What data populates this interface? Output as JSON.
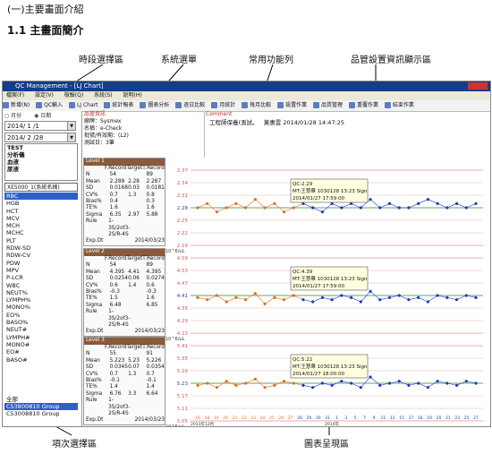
{
  "doc": {
    "section_title": "(一)主要畫面介紹",
    "subsection_title": "1.1 主畫面簡介"
  },
  "callouts": {
    "period": "時段選擇區",
    "system_menu": "系統選單",
    "functions": "常用功能列",
    "manager_info": "品管設置資訊顯示區",
    "items_area": "項次選擇區",
    "chart_area": "圖表呈現區"
  },
  "window": {
    "title": "QC Management - [LJ Chart]",
    "menu": [
      "檔案(F)",
      "設定(V)",
      "檢驗(Q)",
      "系統(S)",
      "說明(H)"
    ],
    "toolbar": [
      "新增(N)",
      "QC輸入",
      "LJ Chart",
      "統計報表",
      "圖表分析",
      "逐日比較",
      "月統計",
      "毎月比較",
      "設置作業",
      "品質管理",
      "重覆作業",
      "結束作業"
    ]
  },
  "left": {
    "radio": [
      "月份",
      "日期"
    ],
    "date_from": "2014/ 1 /1",
    "date_to": "2014/ 2 /28",
    "list1": [
      "TEST",
      "分析儀",
      "血液",
      "尿液"
    ],
    "instrument": "XE5000_1(系統名稱)",
    "items": [
      "RBC",
      "HGB",
      "HCT",
      "MCV",
      "MCH",
      "MCHC",
      "PLT",
      "RDW-SD",
      "RDW-CV",
      "PDW",
      "MPV",
      "P-LCR",
      "WBC",
      "NEUT%",
      "LYMPH%",
      "MONO%",
      "EO%",
      "BASO%",
      "NEUT#",
      "LYMPH#",
      "MONO#",
      "EO#",
      "BASO#"
    ],
    "selected_item": "RBC",
    "groups": [
      "全部",
      "C53800810 Group",
      "C53008810 Group"
    ],
    "selected_group": "C53800810 Group"
  },
  "info": {
    "header": "品管資訊",
    "lines": [
      "廠牌：Sysmex",
      "名稱：e-Check",
      "批號/有效期：(L2)",
      "測試日：3筆"
    ]
  },
  "comment": {
    "header": "Comment",
    "text": "工程師保養(測試。",
    "signed": "黃惠雲 2014/01/28 14:47:25"
  },
  "stats": [
    {
      "level": "Level 1",
      "cols": [
        "",
        "F.Record",
        "Target",
        "T.Record"
      ],
      "rows": [
        [
          "N",
          "54",
          "",
          "89"
        ],
        [
          "Mean",
          "2.289",
          "2.28",
          "2.287"
        ],
        [
          "SD",
          "0.0168",
          "0.03",
          "0.0181"
        ],
        [
          "CV%",
          "0.7",
          "1.3",
          "0.8"
        ],
        [
          "Bias%",
          "0.4",
          "",
          "0.3"
        ],
        [
          "TE%",
          "1.6",
          "",
          "1.6"
        ],
        [
          "Sigma",
          "6.35",
          "2.97",
          "5.88"
        ],
        [
          "Rule",
          "1-3S/2of3-2S/R-4S",
          "",
          ""
        ],
        [
          "Exp.Dt",
          "",
          "",
          "2014/03/23"
        ]
      ]
    },
    {
      "level": "Level 2",
      "cols": [
        "",
        "F.Record",
        "Target",
        "T.Record"
      ],
      "rows": [
        [
          "N",
          "54",
          "",
          "89"
        ],
        [
          "Mean",
          "4.395",
          "4.41",
          "4.395"
        ],
        [
          "SD",
          "0.0254",
          "0.06",
          "0.0274"
        ],
        [
          "CV%",
          "0.6",
          "1.4",
          "0.6"
        ],
        [
          "Bias%",
          "-0.3",
          "",
          "-0.3"
        ],
        [
          "TE%",
          "1.5",
          "",
          "1.6"
        ],
        [
          "Sigma",
          "6.48",
          "",
          "6.85"
        ],
        [
          "Rule",
          "1-3S/2of3-2S/R-4S",
          "",
          ""
        ],
        [
          "Exp.Dt",
          "",
          "",
          "2014/03/23"
        ]
      ]
    },
    {
      "level": "Level 3",
      "cols": [
        "",
        "F.Record",
        "Target",
        "T.Record"
      ],
      "rows": [
        [
          "N",
          "55",
          "",
          "91"
        ],
        [
          "Mean",
          "5.223",
          "5.23",
          "5.226"
        ],
        [
          "SD",
          "0.0345",
          "0.07",
          "0.0354"
        ],
        [
          "CV%",
          "0.7",
          "1.3",
          "0.7"
        ],
        [
          "Bias%",
          "-0.1",
          "",
          "-0.1"
        ],
        [
          "TE%",
          "1.4",
          "",
          "1.4"
        ],
        [
          "Sigma",
          "6.76",
          "3.3",
          "6.64"
        ],
        [
          "Rule",
          "1-3S/2of3-2S/R-4S",
          "",
          ""
        ],
        [
          "Exp.Dt",
          "",
          "",
          "2014/03/23"
        ]
      ]
    }
  ],
  "charts": [
    {
      "yticks": [
        "2.37",
        "2.34",
        "2.31",
        "2.28",
        "2.25",
        "2.22",
        "2.19"
      ],
      "unit": "10^6/uL",
      "tooltip": [
        "QC:2.29",
        "MT:王慧華 1030128 13:23 Sign",
        "2014/01/27 17:59:00"
      ]
    },
    {
      "yticks": [
        "4.59",
        "4.53",
        "4.47",
        "4.41",
        "4.35",
        "4.29",
        "4.23"
      ],
      "unit": "10^6/uL",
      "tooltip": [
        "QC:4.39",
        "MT:王慧華 1030128 13:23 Sign",
        "2014/01/27 17:59:00"
      ]
    },
    {
      "yticks": [
        "5.41",
        "5.35",
        "5.29",
        "5.23",
        "5.17",
        "5.11",
        "5.05"
      ],
      "unit": "10^6/uL",
      "tooltip": [
        "QC:5.22",
        "MT:王慧華 1030128 13:23 Sign",
        "2014/01/27 18:00:00"
      ]
    }
  ],
  "xaxis": {
    "ticks": [
      "16",
      "18",
      "19",
      "20",
      "21",
      "22",
      "23",
      "24",
      "25",
      "26",
      "27",
      "28",
      "29",
      "30",
      "31",
      "1",
      "3",
      "5",
      "7",
      "9",
      "11",
      "13",
      "15",
      "17",
      "18",
      "19",
      "20",
      "21",
      "23",
      "25",
      "27"
    ],
    "label_left": "2013年12月",
    "label_right": "2014年"
  },
  "chart_data": [
    {
      "type": "line",
      "series": [
        {
          "values": [
            2.28,
            2.29,
            2.27,
            2.28,
            2.29,
            2.28,
            2.3,
            2.28,
            2.29,
            2.27,
            2.28,
            2.29,
            2.28,
            2.27,
            2.29,
            2.28,
            2.29,
            2.28,
            2.3,
            2.28,
            2.29,
            2.28,
            2.28,
            2.29,
            2.3,
            2.29,
            2.28,
            2.29,
            2.28,
            2.29
          ]
        }
      ],
      "ylim": [
        2.19,
        2.37
      ]
    },
    {
      "type": "line",
      "series": [
        {
          "values": [
            4.4,
            4.39,
            4.41,
            4.38,
            4.4,
            4.39,
            4.42,
            4.37,
            4.4,
            4.39,
            4.41,
            4.39,
            4.38,
            4.4,
            4.39,
            4.41,
            4.4,
            4.38,
            4.43,
            4.39,
            4.4,
            4.41,
            4.39,
            4.4,
            4.38,
            4.41,
            4.4,
            4.39,
            4.41,
            4.4
          ]
        }
      ],
      "ylim": [
        4.23,
        4.59
      ]
    },
    {
      "type": "line",
      "series": [
        {
          "values": [
            5.22,
            5.23,
            5.21,
            5.24,
            5.22,
            5.23,
            5.25,
            5.21,
            5.22,
            5.24,
            5.23,
            5.22,
            5.21,
            5.23,
            5.22,
            5.24,
            5.23,
            5.21,
            5.26,
            5.22,
            5.23,
            5.24,
            5.22,
            5.23,
            5.21,
            5.24,
            5.23,
            5.22,
            5.24,
            5.23
          ]
        }
      ],
      "ylim": [
        5.05,
        5.41
      ]
    }
  ],
  "colors": {
    "early": "#e07020",
    "late": "#1a3bbf",
    "mean_line": "#2d8c2d",
    "limit_line": "#e05050"
  }
}
